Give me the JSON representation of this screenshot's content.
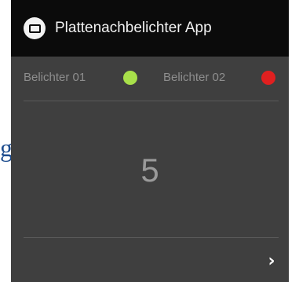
{
  "side_text": "g",
  "app_bar": {
    "title": "Plattenachbelichter App",
    "icon": "monitor-icon"
  },
  "status": [
    {
      "label": "Belichter 01",
      "indicator_color": "#a8e04a"
    },
    {
      "label": "Belichter 02",
      "indicator_color": "#e02020"
    }
  ],
  "counter": {
    "value": "5"
  },
  "navigation": {
    "next_glyph": "›",
    "icon": "chevron-right-icon"
  },
  "colors": {
    "app_bar_bg": "#0b0b0b",
    "panel_bg": "#3f3f3f",
    "label_text": "#8e8e8e",
    "counter_text": "#9a9a9a"
  }
}
